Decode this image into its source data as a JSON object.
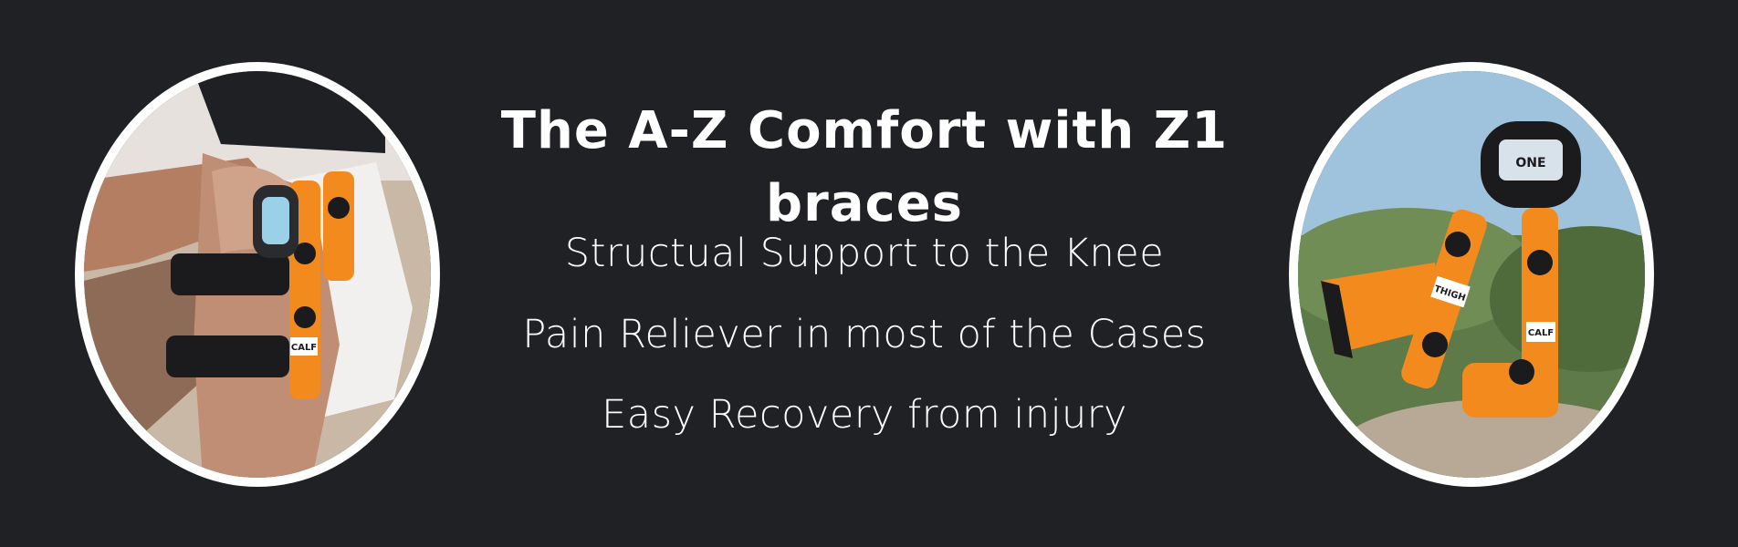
{
  "banner": {
    "title": "The A-Z Comfort with Z1 braces",
    "features": [
      "Structual Support to the Knee",
      "Pain Reliever in most of the Cases",
      "Easy Recovery from injury"
    ],
    "brace_labels": {
      "thigh": "THIGH",
      "calf": "CALF",
      "logo": "ONE"
    },
    "colors": {
      "background": "#202125",
      "text": "#ffffff",
      "brace_orange": "#f28a1e",
      "frame": "#ffffff"
    }
  }
}
